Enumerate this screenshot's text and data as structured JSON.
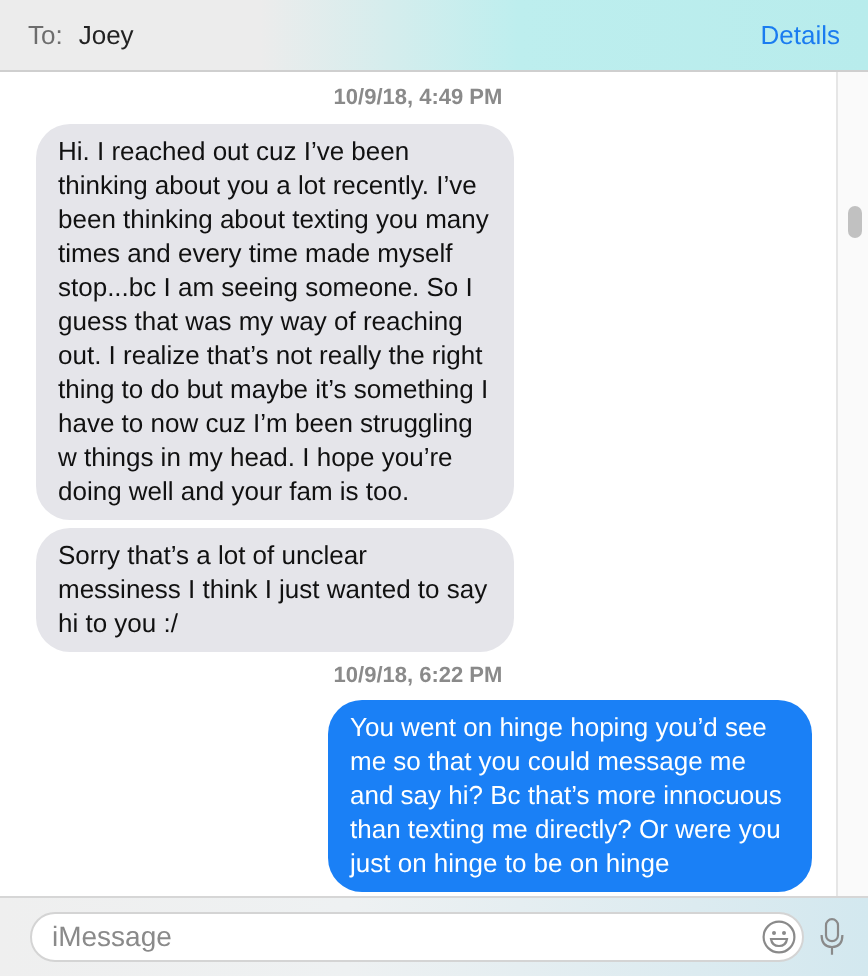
{
  "header": {
    "to_label": "To:",
    "recipient": "Joey",
    "details": "Details"
  },
  "messages": [
    {
      "kind": "timestamp",
      "text": "10/9/18, 4:49 PM"
    },
    {
      "kind": "incoming",
      "text": "Hi. I reached out cuz I’ve been thinking about you a lot recently. I’ve been thinking about texting you many times and every time made myself stop...bc I am seeing someone. So I guess that was my way of reaching out. I realize that’s not really the right thing to do but maybe it’s something I have to now cuz I’m been struggling w things in my head. I hope you’re doing well and your fam is too."
    },
    {
      "kind": "incoming",
      "text": "Sorry that’s a lot of unclear messiness I think I just wanted to say hi to you :/"
    },
    {
      "kind": "timestamp",
      "text": "10/9/18, 6:22 PM"
    },
    {
      "kind": "outgoing",
      "text": "You went on hinge hoping you’d see me so that you could message me and say hi? Bc that’s more innocuous than texting me directly? Or were you just on hinge to be on hinge"
    }
  ],
  "composer": {
    "placeholder": "iMessage"
  }
}
